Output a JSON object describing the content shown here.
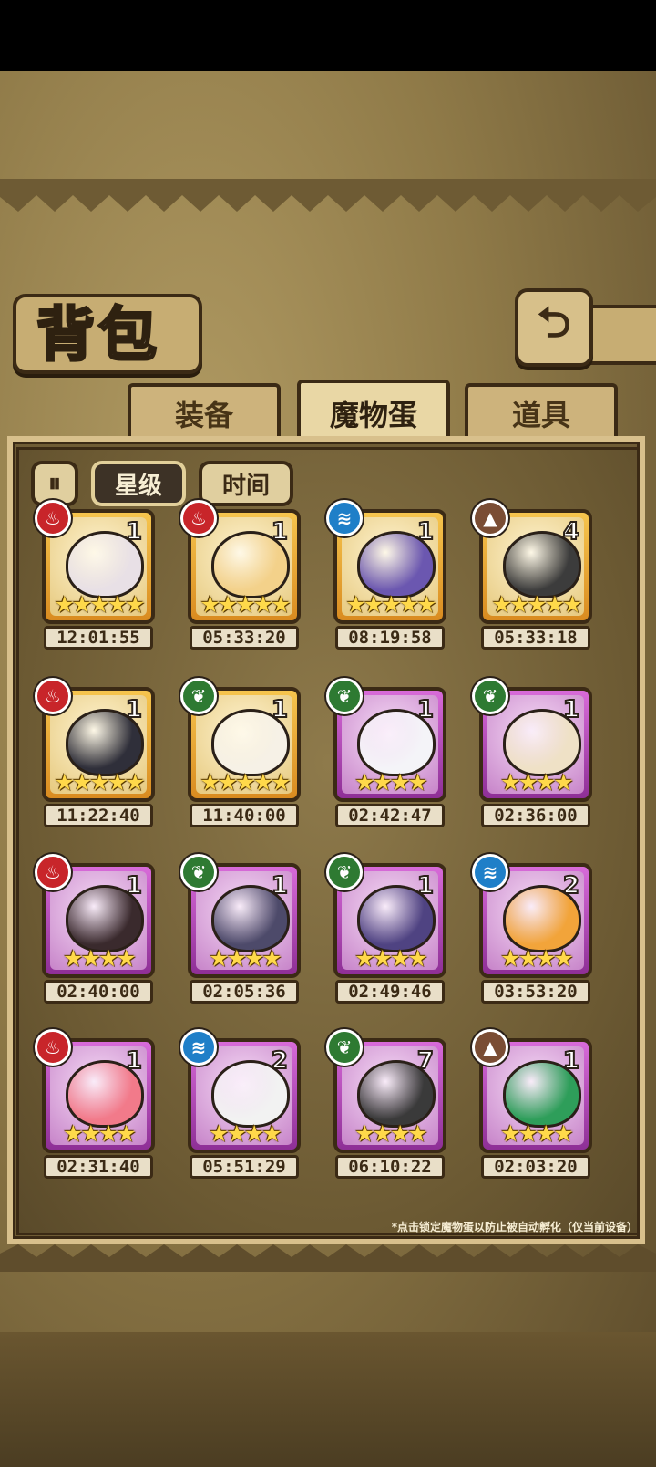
{
  "header": {
    "title": "背包",
    "back_icon": "back-arrow-icon"
  },
  "tabs": [
    {
      "label": "装备",
      "active": false
    },
    {
      "label": "魔物蛋",
      "active": true
    },
    {
      "label": "道具",
      "active": false
    }
  ],
  "sort": {
    "lock_icon": "pause-lock-icon",
    "star_label": "星级",
    "time_label": "时间"
  },
  "eggs": [
    {
      "element": "fire",
      "count": "1",
      "stars": 5,
      "timer": "12:01:55",
      "frame": "gold",
      "color": "#e8e0e6"
    },
    {
      "element": "fire",
      "count": "1",
      "stars": 5,
      "timer": "05:33:20",
      "frame": "gold",
      "color": "#f3d18a"
    },
    {
      "element": "water",
      "count": "1",
      "stars": 5,
      "timer": "08:19:58",
      "frame": "gold",
      "color": "#6b57b0"
    },
    {
      "element": "earth",
      "count": "4",
      "stars": 5,
      "timer": "05:33:18",
      "frame": "gold",
      "color": "#3c3c3c"
    },
    {
      "element": "fire",
      "count": "1",
      "stars": 5,
      "timer": "11:22:40",
      "frame": "gold",
      "color": "#2f2f3a"
    },
    {
      "element": "nature",
      "count": "1",
      "stars": 5,
      "timer": "11:40:00",
      "frame": "gold",
      "color": "#f6f1e6"
    },
    {
      "element": "nature",
      "count": "1",
      "stars": 4,
      "timer": "02:42:47",
      "frame": "purple",
      "color": "#f4f4f8"
    },
    {
      "element": "nature",
      "count": "1",
      "stars": 4,
      "timer": "02:36:00",
      "frame": "purple",
      "color": "#efe1c6"
    },
    {
      "element": "fire",
      "count": "1",
      "stars": 4,
      "timer": "02:40:00",
      "frame": "purple",
      "color": "#3a2a2d"
    },
    {
      "element": "nature",
      "count": "1",
      "stars": 4,
      "timer": "02:05:36",
      "frame": "purple",
      "color": "#4d4a6a"
    },
    {
      "element": "nature",
      "count": "1",
      "stars": 4,
      "timer": "02:49:46",
      "frame": "purple",
      "color": "#4f4382"
    },
    {
      "element": "water",
      "count": "2",
      "stars": 4,
      "timer": "03:53:20",
      "frame": "purple",
      "color": "#f2a43a"
    },
    {
      "element": "fire",
      "count": "1",
      "stars": 4,
      "timer": "02:31:40",
      "frame": "purple",
      "color": "#f27a8a"
    },
    {
      "element": "water",
      "count": "2",
      "stars": 4,
      "timer": "05:51:29",
      "frame": "purple",
      "color": "#f2f2f2"
    },
    {
      "element": "nature",
      "count": "7",
      "stars": 4,
      "timer": "06:10:22",
      "frame": "purple",
      "color": "#3a3a3a"
    },
    {
      "element": "earth",
      "count": "1",
      "stars": 4,
      "timer": "02:03:20",
      "frame": "purple",
      "color": "#2e9e5a"
    }
  ],
  "footer_note": "*点击锁定魔物蛋以防止被自动孵化（仅当前设备）"
}
